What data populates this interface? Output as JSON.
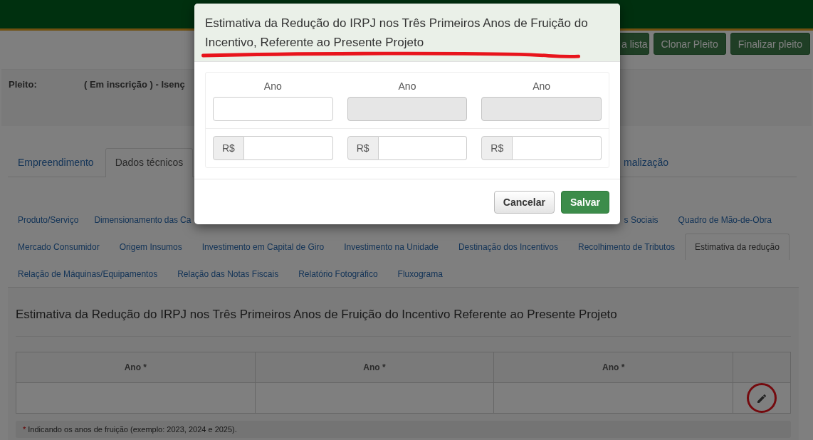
{
  "header": {
    "buttons": [
      "a lista",
      "Clonar Pleito",
      "Finalizar pleito"
    ]
  },
  "pleito": {
    "label": "Pleito:",
    "status": "( **Em inscrição** ) - Isenç"
  },
  "main_tabs": [
    {
      "label": "Empreendimento",
      "selected": false
    },
    {
      "label": "Dados técnicos",
      "selected": true
    },
    {
      "label": "malização",
      "selected": false
    }
  ],
  "sub_tab_rows": [
    [
      {
        "label": "Produto/Serviço",
        "selected": false
      },
      {
        "label": "Dimensionamento das Ca",
        "selected": false
      },
      {
        "label": "s Sociais",
        "selected": false
      },
      {
        "label": "Quadro de Mão-de-Obra",
        "selected": false
      }
    ],
    [
      {
        "label": "Mercado Consumidor",
        "selected": false
      },
      {
        "label": "Origem Insumos",
        "selected": false
      },
      {
        "label": "Investimento em Capital de Giro",
        "selected": false
      },
      {
        "label": "Investimento na Unidade",
        "selected": false
      },
      {
        "label": "Destinação dos Incentivos",
        "selected": false
      },
      {
        "label": "Recolhimento de Tributos",
        "selected": false
      },
      {
        "label": "Estimativa da redução",
        "selected": true
      }
    ],
    [
      {
        "label": "Relação de Máquinas/Equipamentos",
        "selected": false
      },
      {
        "label": "Relação das Notas Fiscais",
        "selected": false
      },
      {
        "label": "Relatório Fotográfico",
        "selected": false
      },
      {
        "label": "Fluxograma",
        "selected": false
      }
    ]
  ],
  "section": {
    "title": "Estimativa da Redução do IRPJ nos Três Primeiros Anos de Fruição do Incentivo Referente ao Presente Projeto",
    "table": {
      "columns": [
        "Ano *",
        "Ano *",
        "Ano *"
      ]
    },
    "footnote": {
      "mark": "*",
      "text": "Indicando os anos de fruição (exemplo: 2023, 2024 e 2025)."
    }
  },
  "modal": {
    "title": "Estimativa da Redução do IRPJ nos Três Primeiros Anos de Fruição do Incentivo, Referente ao Presente Projeto",
    "years": [
      {
        "label": "Ano",
        "disabled": false
      },
      {
        "label": "Ano",
        "disabled": true
      },
      {
        "label": "Ano",
        "disabled": true
      }
    ],
    "amounts": [
      {
        "prefix": "R$"
      },
      {
        "prefix": "R$"
      },
      {
        "prefix": "R$"
      }
    ],
    "buttons": [
      {
        "label": "Cancelar",
        "kind": "default"
      },
      {
        "label": "Salvar",
        "kind": "primary"
      }
    ]
  }
}
